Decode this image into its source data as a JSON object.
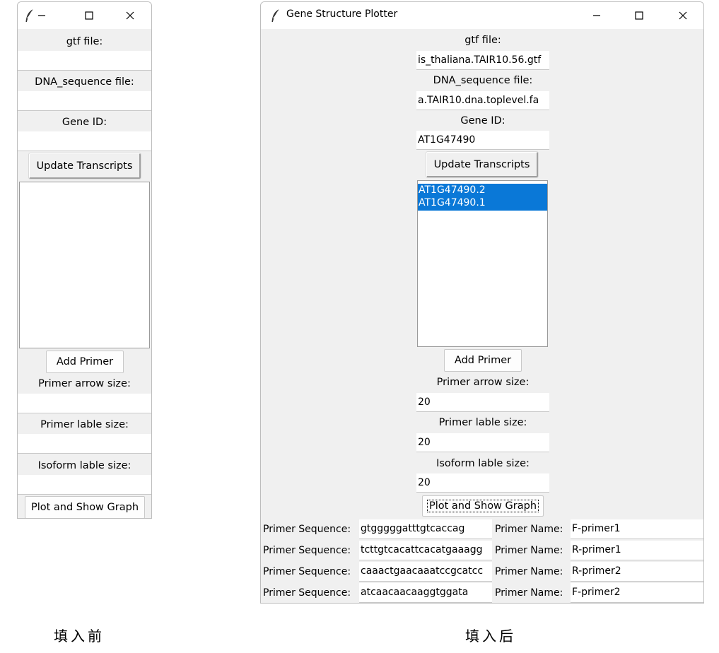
{
  "before_window": {
    "title": "",
    "labels": {
      "gtf": "gtf file:",
      "dna": "DNA_sequence file:",
      "gene_id": "Gene ID:",
      "arrow_size": "Primer arrow size:",
      "primer_label_size": "Primer lable size:",
      "isoform_label_size": "Isoform lable size:"
    },
    "values": {
      "gtf": "",
      "dna": "",
      "gene_id": "",
      "arrow_size": "",
      "primer_label_size": "",
      "isoform_label_size": ""
    },
    "buttons": {
      "update": "Update Transcripts",
      "add_primer": "Add Primer",
      "plot": "Plot and Show Graph"
    },
    "transcripts": []
  },
  "after_window": {
    "title": "Gene Structure Plotter",
    "labels": {
      "gtf": "gtf file:",
      "dna": "DNA_sequence file:",
      "gene_id": "Gene ID:",
      "arrow_size": "Primer arrow size:",
      "primer_label_size": "Primer lable size:",
      "isoform_label_size": "Isoform lable size:"
    },
    "values": {
      "gtf": "is_thaliana.TAIR10.56.gtf",
      "dna": "a.TAIR10.dna.toplevel.fa",
      "gene_id": "AT1G47490",
      "arrow_size": "20",
      "primer_label_size": "20",
      "isoform_label_size": "20"
    },
    "buttons": {
      "update": "Update Transcripts",
      "add_primer": "Add Primer",
      "plot": "Plot and Show Graph"
    },
    "transcripts": [
      "AT1G47490.2",
      "AT1G47490.1"
    ],
    "primer_sequence_label": "Primer Sequence:",
    "primer_name_label": "Primer Name:",
    "primers": [
      {
        "sequence": "gtgggggatttgtcaccag",
        "name": "F-primer1"
      },
      {
        "sequence": "tcttgtcacattcacatgaaagg",
        "name": "R-primer1"
      },
      {
        "sequence": "caaactgaacaaatccgcatcc",
        "name": "R-primer2"
      },
      {
        "sequence": "atcaacaacaaggtggata",
        "name": "F-primer2"
      }
    ]
  },
  "captions": {
    "before": "填入前",
    "after": "填入后"
  },
  "icons": {
    "app": "feather-icon",
    "minimize": "minimize-icon",
    "maximize": "maximize-icon",
    "close": "close-icon"
  },
  "colors": {
    "selection": "#0a78d7",
    "window_bg": "#f0f0f0",
    "entry_bg": "#ffffff"
  }
}
